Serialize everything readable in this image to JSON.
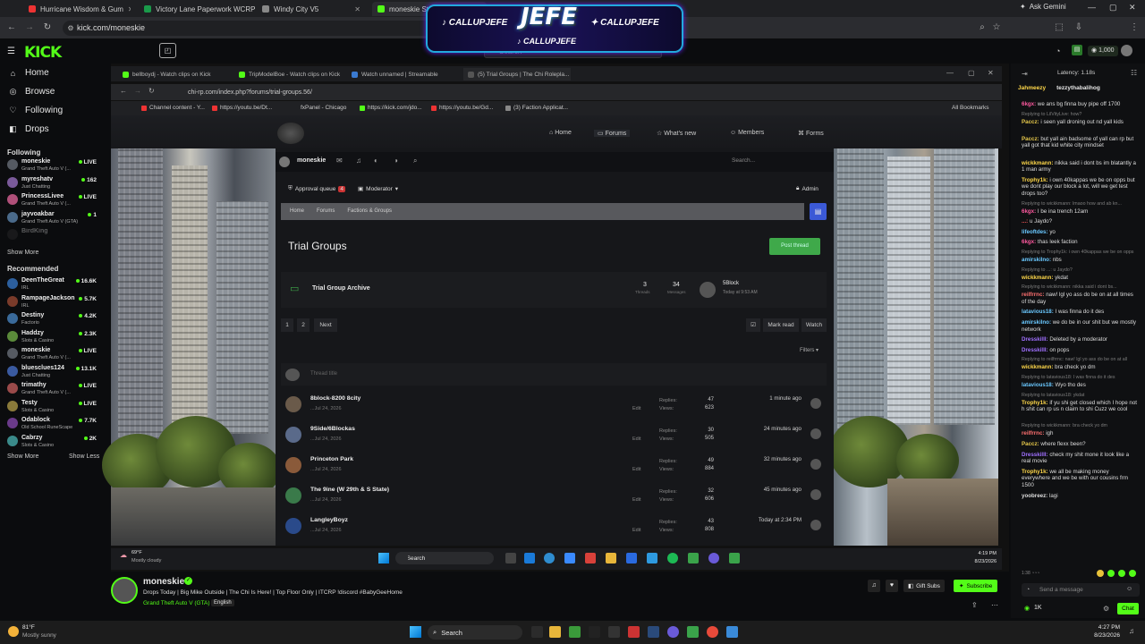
{
  "outer_browser": {
    "tabs": [
      "Hurricane Wisdom & Gum",
      "Victory Lane Paperwork WCRP",
      "Windy City V5",
      "moneskie Stream - Watch"
    ],
    "url": "kick.com/moneskie",
    "ask_gemini": "Ask Gemini"
  },
  "kick": {
    "logo": "KICK",
    "search_placeholder": "Search",
    "points": "1,000",
    "nav": [
      {
        "label": "Home",
        "icon": "home-icon"
      },
      {
        "label": "Browse",
        "icon": "compass-icon"
      },
      {
        "label": "Following",
        "icon": "heart-icon"
      },
      {
        "label": "Drops",
        "icon": "gift-icon"
      }
    ],
    "following_header": "Following",
    "following": [
      {
        "name": "moneskie",
        "game": "Grand Theft Auto V (...",
        "viewers": "LIVE",
        "color": "#555a62"
      },
      {
        "name": "myreshatv",
        "game": "Just Chatting",
        "viewers": "162",
        "color": "#7a5a9a"
      },
      {
        "name": "PrincessLivee",
        "game": "Grand Theft Auto V (...",
        "viewers": "LIVE",
        "color": "#b0507a"
      },
      {
        "name": "jayvoakbar",
        "game": "Grand Theft Auto V (GTA)",
        "viewers": "1",
        "color": "#4a6a8a"
      },
      {
        "name": "BirdKing",
        "game": "",
        "viewers": "",
        "color": "#333"
      }
    ],
    "show_more": "Show More",
    "recommended_header": "Recommended",
    "recommended": [
      {
        "name": "DeenTheGreat",
        "game": "IRL",
        "viewers": "16.6K",
        "color": "#2c5f9e"
      },
      {
        "name": "RampageJackson",
        "game": "IRL",
        "viewers": "5.7K",
        "color": "#7a3b2a"
      },
      {
        "name": "Destiny",
        "game": "Factorio",
        "viewers": "4.2K",
        "color": "#3a6a9a"
      },
      {
        "name": "Haddzy",
        "game": "Slots & Casino",
        "viewers": "2.3K",
        "color": "#5a8a3a"
      },
      {
        "name": "moneskie",
        "game": "Grand Theft Auto V (...",
        "viewers": "LIVE",
        "color": "#555a62"
      },
      {
        "name": "bluesclues124",
        "game": "Just Chatting",
        "viewers": "13.1K",
        "color": "#3a5aa0"
      },
      {
        "name": "trimathy",
        "game": "Grand Theft Auto V (...",
        "viewers": "LIVE",
        "color": "#9a4a4a"
      },
      {
        "name": "Testy",
        "game": "Slots & Casino",
        "viewers": "LIVE",
        "color": "#8a7a3a"
      },
      {
        "name": "Odablock",
        "game": "Old School RuneScape",
        "viewers": "7.7K",
        "color": "#6a3a8a"
      },
      {
        "name": "Cabrzy",
        "game": "Slots & Casino",
        "viewers": "2K",
        "color": "#3a8a8a"
      }
    ],
    "show_more_2": "Show More",
    "show_less": "Show Less"
  },
  "overlay": {
    "title": "JEFE",
    "handle_left": "CALLUPJEFE",
    "handle_right": "CALLUPJEFE",
    "handle_bottom": "CALLUPJEFE"
  },
  "inner_browser": {
    "tabs": [
      "bellboydj - Watch clips on Kick",
      "TripModelBoe - Watch clips on Kick",
      "Watch unnamed | Streamable",
      "(5) Trial Groups | The Chi Rolepla..."
    ],
    "url": "chi-rp.com/index.php?forums/trial-groups.56/",
    "bookmarks": [
      "Channel content - Y...",
      "https://youtu.be/Dt...",
      "fxPanel - Chicago",
      "https://kick.com/jdo...",
      "https://youtu.be/Gd...",
      "(3) Faction Applicat..."
    ],
    "all_bookmarks": "All Bookmarks"
  },
  "forum": {
    "nav": [
      "Home",
      "Forums",
      "What's new",
      "Members",
      "Forms"
    ],
    "user": "moneskie",
    "search": "Search...",
    "approval": "Approval queue",
    "approval_count": "4",
    "moderator": "Moderator",
    "admin": "Admin",
    "crumbs": [
      "Home",
      "Forums",
      "Factions & Groups"
    ],
    "title": "Trial Groups",
    "post_thread": "Post thread",
    "archive": {
      "name": "Trial Group Archive",
      "threads": "3",
      "threads_label": "Threads",
      "messages": "34",
      "messages_label": "Messages",
      "latest": "5Block",
      "latest_time": "Today at 9:53 AM"
    },
    "pages": [
      "1",
      "2"
    ],
    "next": "Next",
    "mark_read": "Mark read",
    "watch": "Watch",
    "filters": "Filters",
    "thread_title_placeholder": "Thread title",
    "replies_label": "Replies:",
    "views_label": "Views:",
    "edit": "Edit",
    "threads": [
      {
        "title": "8block-8200 8city",
        "starter": "...Jul 24, 2026",
        "replies": "47",
        "views": "623",
        "time": "1 minute ago",
        "avatar": "#6a5a4a"
      },
      {
        "title": "9Side/6Blockas",
        "starter": "...Jul 24, 2026",
        "replies": "30",
        "views": "505",
        "time": "24 minutes ago",
        "avatar": "#5a6a8a"
      },
      {
        "title": "Princeton Park",
        "starter": "...Jul 24, 2026",
        "replies": "49",
        "views": "884",
        "time": "32 minutes ago",
        "avatar": "#8a5a3a"
      },
      {
        "title": "The 9ine (W 29th & S State)",
        "starter": "...Jul 24, 2026",
        "replies": "32",
        "views": "606",
        "time": "45 minutes ago",
        "avatar": "#3a7a4a"
      },
      {
        "title": "LangleyBoyz",
        "starter": "...Jul 24, 2026",
        "replies": "43",
        "views": "808",
        "time": "Today at 2:34 PM",
        "avatar": "#2a4a8a"
      }
    ]
  },
  "inner_taskbar": {
    "weather_temp": "69°F",
    "weather_desc": "Mostly cloudy",
    "search": "Search",
    "time": "4:19 PM",
    "date": "8/23/2026"
  },
  "chat": {
    "latency": "Latency: 1.18s",
    "pinned": [
      "Jahmeezy",
      "tezzythabalihog"
    ],
    "messages": [
      {
        "user": "6kgx:",
        "text": "we ans bg finna buy pipe off 1700",
        "color": "#ff5aa0"
      },
      {
        "reply": "Replying to LilVityLive: how?"
      },
      {
        "user": "Paccz:",
        "text": "i seen yall droning out nd yall kids",
        "color": "#e6c84a"
      },
      {
        "user": "Paccz:",
        "text": "but yall ain badsome of yall can rp but yall got that kid white city mindset",
        "color": "#e6c84a"
      },
      {
        "user": "wickkmann:",
        "text": "nikka said i dont bs im blatantly a 1 man army",
        "color": "#ffd84a"
      },
      {
        "user": "Trophy1k:",
        "text": "i own 40kappas we be on opps but we dont play our block a lot, will we get test drops too?",
        "color": "#ffd84a"
      },
      {
        "reply": "Replying to wickkmann: lmaoo how and ab kn..."
      },
      {
        "user": "6kgx:",
        "text": "I be ina trench 12am",
        "color": "#ff5aa0"
      },
      {
        "user": "...:",
        "text": "u Jaydo?",
        "color": "#ff5a5a"
      },
      {
        "user": "lifeoftdes:",
        "text": "yo",
        "color": "#6ac8ff"
      },
      {
        "user": "6kgx:",
        "text": "thas leek faction",
        "color": "#ff5aa0"
      },
      {
        "reply": "Replying to Trophy1k: i own 40kappas we be on opps"
      },
      {
        "user": "amirskilno:",
        "text": "nbs",
        "color": "#6ac8ff"
      },
      {
        "reply": "Replying to ...: u Jaydo?"
      },
      {
        "user": "wickkmann:",
        "text": "ykdat",
        "color": "#ffd84a"
      },
      {
        "reply": "Replying to wickkmann: nikka said i dont bs..."
      },
      {
        "user": "reilfrrnc:",
        "text": "naw! lgl yo ass do be on at all times of the day",
        "color": "#ff7070"
      },
      {
        "user": "latavious18:",
        "text": "I was finna do it des",
        "color": "#6ac8ff"
      },
      {
        "user": "amirskilno:",
        "text": "we do be in our shit but we mostly network",
        "color": "#6ac8ff"
      },
      {
        "user": "DresskillI:",
        "text": "Deleted by a moderator",
        "color": "#a070ff"
      },
      {
        "user": "DresskillI:",
        "text": "on pops",
        "color": "#a070ff"
      },
      {
        "reply": "Replying to reilfrrnc: naw! lgl yo ass do be on at all"
      },
      {
        "user": "wickkmann:",
        "text": "bra check yo dm",
        "color": "#ffd84a"
      },
      {
        "reply": "Replying to latavious18: I was finna do it des"
      },
      {
        "user": "latavious18:",
        "text": "Wyo tho des",
        "color": "#6ac8ff"
      },
      {
        "reply": "Replying to latavious18: ykdat"
      },
      {
        "user": "Trophy1k:",
        "text": "if yu shi get closed which I hope not h shit can rp us n claim to shi Cuzz we cool",
        "color": "#ffd84a"
      },
      {
        "reply": "Replying to wickkmann: bra check yo dm"
      },
      {
        "user": "reilfrrnc:",
        "text": "igh",
        "color": "#ff7070"
      },
      {
        "user": "Paccz:",
        "text": "where flexx been?",
        "color": "#e6c84a"
      },
      {
        "user": "DresskillI:",
        "text": "check my shit mone it look like a real movie",
        "color": "#a070ff"
      },
      {
        "user": "Trophy1k:",
        "text": "we all be making money everywhere and we be with our cousins frm 1500",
        "color": "#ffd84a"
      },
      {
        "user": "yoobreez:",
        "text": "lagi",
        "color": "#dddddd"
      }
    ],
    "send_placeholder": "Send a message",
    "viewer_count": "1K",
    "chat_btn": "Chat"
  },
  "stream_info": {
    "name": "moneskie",
    "title": "Drops Today | Big Mike Outside | The Chi Is Here! | Top Floor Only | ITCRP !discord #BabyGeeHome",
    "category": "Grand Theft Auto V (GTA)",
    "language": "English",
    "gift_subs": "Gift Subs",
    "subscribe": "Subscribe"
  },
  "taskbar": {
    "weather_temp": "81°F",
    "weather_desc": "Mostly sunny",
    "search": "Search",
    "time": "4:27 PM",
    "date": "8/23/2026"
  }
}
